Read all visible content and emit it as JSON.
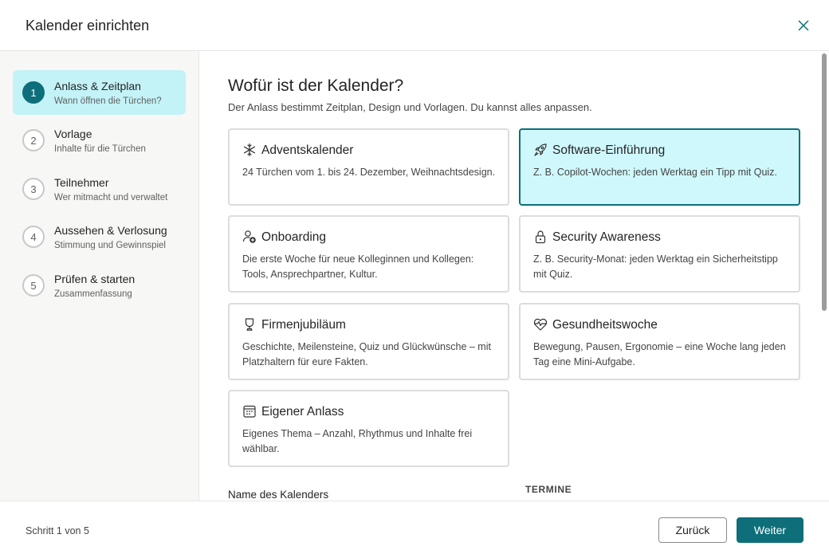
{
  "header": {
    "title": "Kalender einrichten",
    "close_icon": "close-icon"
  },
  "steps": [
    {
      "num": "1",
      "title": "Anlass & Zeitplan",
      "sub": "Wann öffnen die Türchen?",
      "active": true
    },
    {
      "num": "2",
      "title": "Vorlage",
      "sub": "Inhalte für die Türchen",
      "active": false
    },
    {
      "num": "3",
      "title": "Teilnehmer",
      "sub": "Wer mitmacht und verwaltet",
      "active": false
    },
    {
      "num": "4",
      "title": "Aussehen & Verlosung",
      "sub": "Stimmung und Gewinnspiel",
      "active": false
    },
    {
      "num": "5",
      "title": "Prüfen & starten",
      "sub": "Zusammenfassung",
      "active": false
    }
  ],
  "main": {
    "title": "Wofür ist der Kalender?",
    "subtitle": "Der Anlass bestimmt Zeitplan, Design und Vorlagen. Du kannst alles anpassen.",
    "cards": [
      {
        "icon": "snowflake-icon",
        "title": "Adventskalender",
        "desc": "24 Türchen vom 1. bis 24. Dezember, Weihnachtsdesign.",
        "selected": false
      },
      {
        "icon": "rocket-icon",
        "title": "Software-Einführung",
        "desc": "Z. B. Copilot-Wochen: jeden Werktag ein Tipp mit Quiz.",
        "selected": true
      },
      {
        "icon": "person-add-icon",
        "title": "Onboarding",
        "desc": "Die erste Woche für neue Kolleginnen und Kollegen: Tools, Ansprechpartner, Kultur.",
        "selected": false
      },
      {
        "icon": "lock-icon",
        "title": "Security Awareness",
        "desc": "Z. B. Security-Monat: jeden Werktag ein Sicherheitstipp mit Quiz.",
        "selected": false
      },
      {
        "icon": "trophy-icon",
        "title": "Firmenjubiläum",
        "desc": "Geschichte, Meilensteine, Quiz und Glückwünsche – mit Platzhaltern für eure Fakten.",
        "selected": false
      },
      {
        "icon": "heart-pulse-icon",
        "title": "Gesundheitswoche",
        "desc": "Bewegung, Pausen, Ergonomie – eine Woche lang jeden Tag eine Mini-Aufgabe.",
        "selected": false
      },
      {
        "icon": "calendar-icon",
        "title": "Eigener Anlass",
        "desc": "Eigenes Thema – Anzahl, Rhythmus und Inhalte frei wählbar.",
        "selected": false
      }
    ],
    "name_label": "Name des Kalenders",
    "dates_label": "TERMINE"
  },
  "footer": {
    "step_text": "Schritt 1 von 5",
    "back_label": "Zurück",
    "next_label": "Weiter"
  },
  "colors": {
    "accent": "#0e6f7a",
    "selected_bg": "#cff8fc",
    "active_step_bg": "#c3f2f7"
  }
}
